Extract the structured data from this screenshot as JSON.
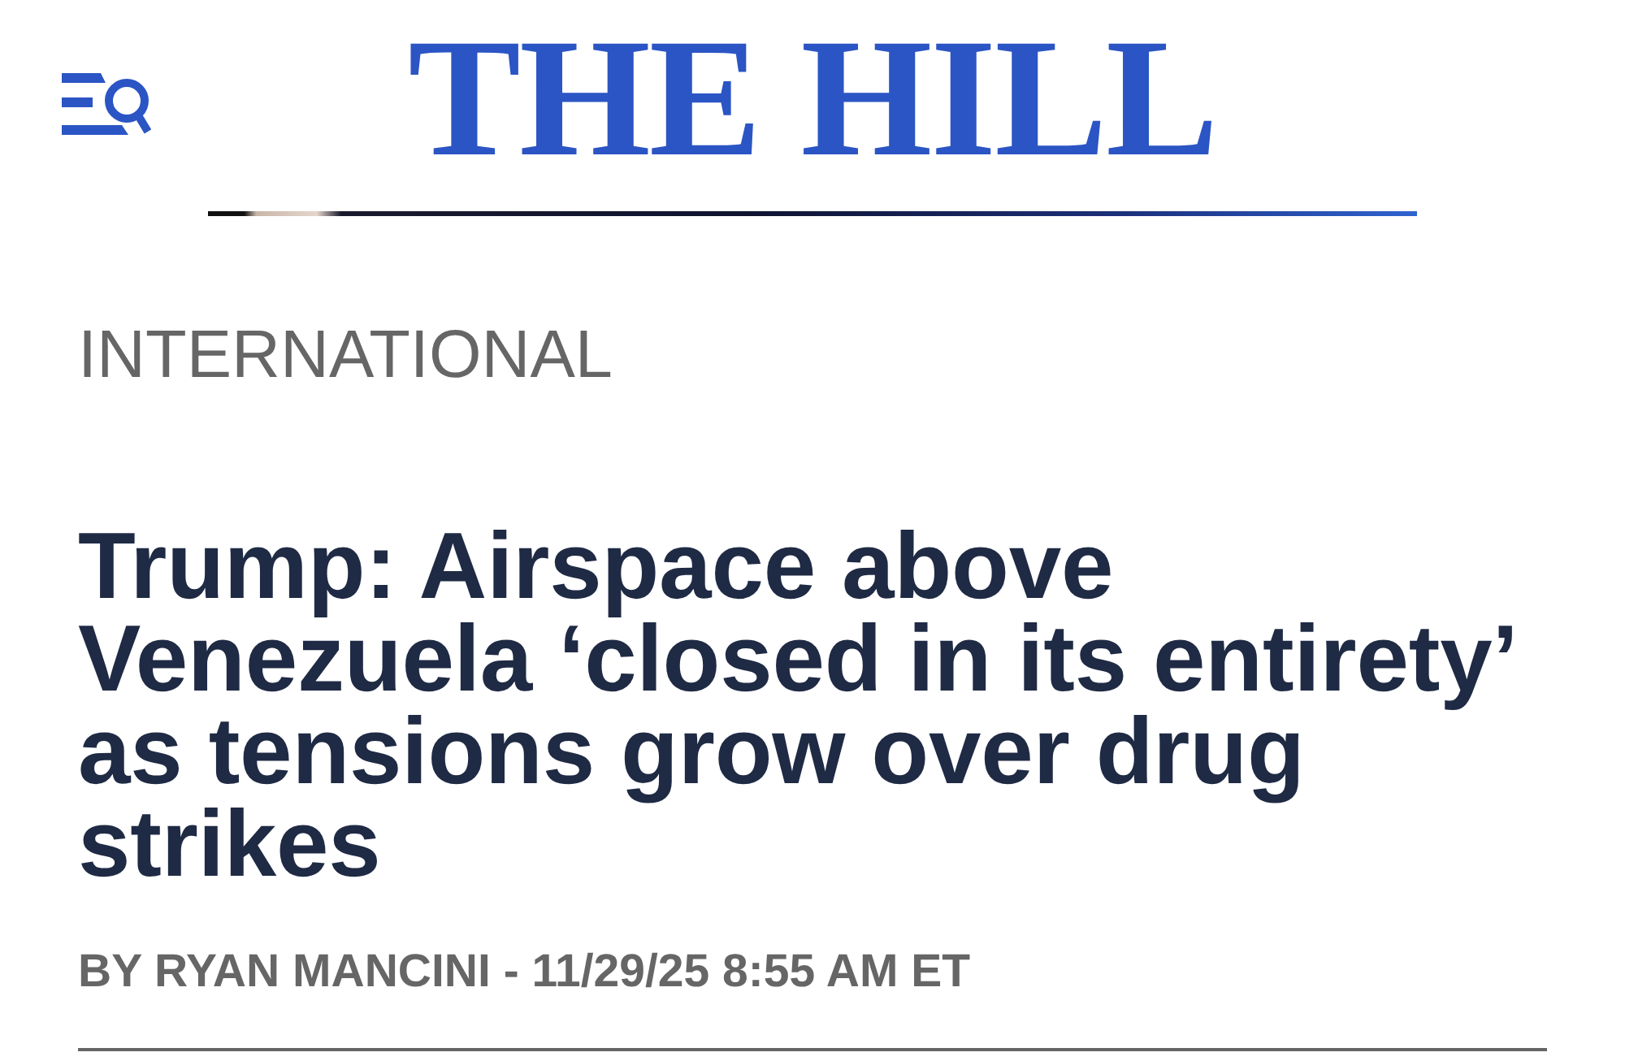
{
  "header": {
    "logo": "THE HILL"
  },
  "article": {
    "section": "INTERNATIONAL",
    "headline": "Trump: Airspace above Venezuela ‘closed in its entirety’ as tensions grow over drug strikes",
    "byline": "BY RYAN MANCINI - 11/29/25 8:55 AM ET"
  }
}
